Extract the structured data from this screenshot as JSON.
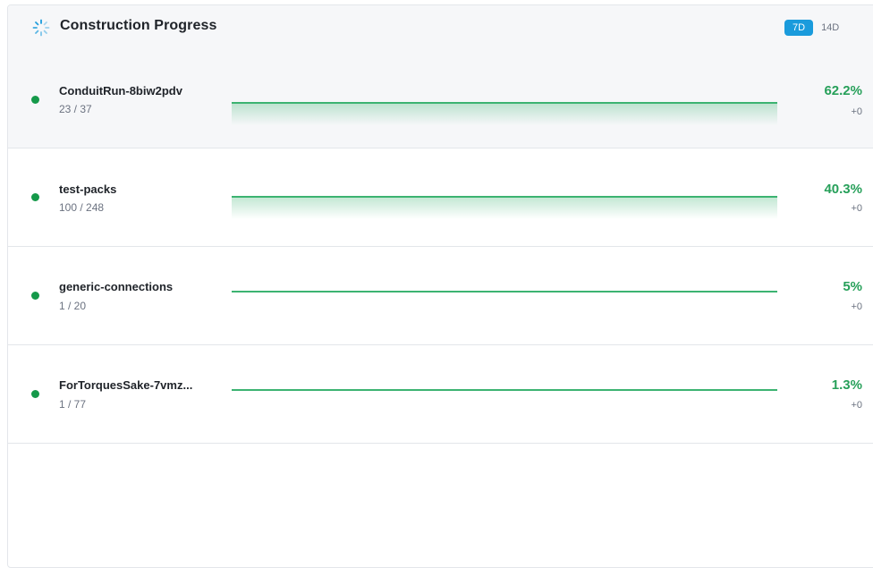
{
  "header": {
    "title": "Construction Progress",
    "icon": "loading-spinner-icon",
    "range_options": [
      {
        "label": "7D",
        "active": true
      },
      {
        "label": "14D",
        "active": false
      }
    ]
  },
  "colors": {
    "accent": "#1a9bdc",
    "success": "#27a05a",
    "dot": "#15994a"
  },
  "rows": [
    {
      "name": "ConduitRun-8biw2pdv",
      "count": "23 / 37",
      "percent": "62.2%",
      "delta": "+0",
      "progress": 0.622
    },
    {
      "name": "test-packs",
      "count": "100 / 248",
      "percent": "40.3%",
      "delta": "+0",
      "progress": 0.403
    },
    {
      "name": "generic-connections",
      "count": "1 / 20",
      "percent": "5%",
      "delta": "+0",
      "progress": 0.05
    },
    {
      "name": "ForTorquesSake-7vmz...",
      "count": "1 / 77",
      "percent": "1.3%",
      "delta": "+0",
      "progress": 0.013
    }
  ]
}
